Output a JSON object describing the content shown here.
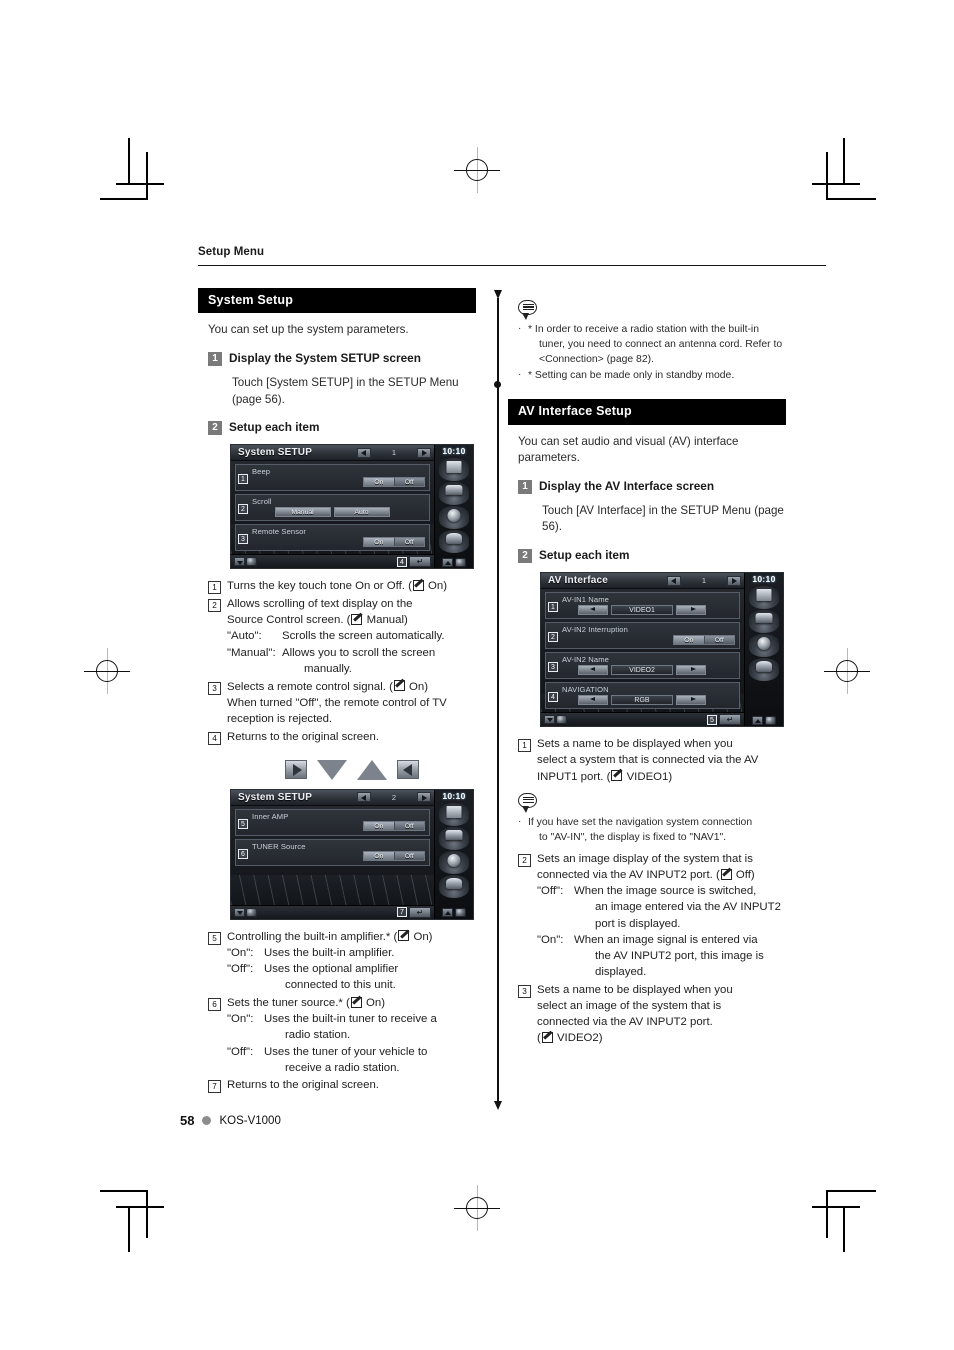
{
  "page": {
    "running_head": "Setup Menu",
    "page_number": "58",
    "model": "KOS-V1000"
  },
  "left_column": {
    "section": {
      "title": "System Setup",
      "intro": "You can set up the system parameters.",
      "steps": [
        {
          "num": "1",
          "label": "Display the System SETUP screen",
          "body": "Touch [System SETUP] in the SETUP Menu (page 56)."
        },
        {
          "num": "2",
          "label": "Setup each item",
          "body": ""
        }
      ]
    },
    "screenshot_1": {
      "title": "System SETUP",
      "page_indicator": "1",
      "clock": "10:10",
      "rows": [
        {
          "marker": "1",
          "label": "Beep",
          "control": "onoff",
          "on": "On",
          "off": "Off",
          "selected": "On"
        },
        {
          "marker": "2",
          "label": "Scroll",
          "control": "pair",
          "left": "Manual",
          "right": "Auto"
        },
        {
          "marker": "3",
          "label": "Remote Sensor",
          "control": "onoff",
          "on": "On",
          "off": "Off",
          "selected": "On"
        }
      ],
      "return_marker": "4"
    },
    "legend_1": [
      {
        "num": "1",
        "lines": [
          "Turns the key touch tone On or Off. (✎ On)"
        ]
      },
      {
        "num": "2",
        "lines": [
          "Allows scrolling of text display on the",
          "Source Control screen. (✎ Manual)"
        ],
        "subs": [
          {
            "key": "\"Auto\":",
            "val": "Scrolls the screen automatically."
          },
          {
            "key": "\"Manual\":",
            "val": "Allows you to scroll the screen"
          },
          {
            "key": "",
            "val": "manually.",
            "deep": true
          }
        ]
      },
      {
        "num": "3",
        "lines": [
          "Selects a remote control signal. (✎ On)",
          "When turned \"Off\", the remote control of TV",
          "reception is rejected."
        ]
      },
      {
        "num": "4",
        "lines": [
          "Returns to the original screen."
        ]
      }
    ],
    "arrow_cluster": [
      "arrow-right-button",
      "arrow-down-triangle",
      "arrow-up-triangle",
      "arrow-left-button"
    ],
    "screenshot_2": {
      "title": "System SETUP",
      "page_indicator": "2",
      "clock": "10:10",
      "rows": [
        {
          "marker": "5",
          "label": "Inner AMP",
          "control": "onoff",
          "on": "On",
          "off": "Off",
          "selected": "On"
        },
        {
          "marker": "6",
          "label": "TUNER Source",
          "control": "onoff",
          "on": "On",
          "off": "Off",
          "selected": "On"
        }
      ],
      "return_marker": "7"
    },
    "legend_2": [
      {
        "num": "5",
        "lines": [
          "Controlling the built-in amplifier.* (✎ On)"
        ],
        "subs": [
          {
            "key": "\"On\":",
            "val": "Uses the built-in amplifier."
          },
          {
            "key": "\"Off\":",
            "val": "Uses the optional amplifier"
          },
          {
            "key": "",
            "val": "connected to this unit.",
            "deep": true
          }
        ]
      },
      {
        "num": "6",
        "lines": [
          "Sets the tuner source.* (✎ On)"
        ],
        "subs": [
          {
            "key": "\"On\":",
            "val": "Uses the built-in tuner to receive a"
          },
          {
            "key": "",
            "val": "radio station.",
            "deep": true
          },
          {
            "key": "\"Off\":",
            "val": "Uses the tuner of your vehicle to"
          },
          {
            "key": "",
            "val": "receive a radio station.",
            "deep": true
          }
        ]
      },
      {
        "num": "7",
        "lines": [
          "Returns to the original screen."
        ]
      }
    ]
  },
  "right_column": {
    "note_top": {
      "icon": "note-bubble-icon",
      "items": [
        {
          "first": "* In order to receive a radio station with the built-in",
          "cont": [
            "tuner, you need to connect an antenna cord. Refer to",
            "<Connection> (page 82)."
          ]
        },
        {
          "first": "* Setting can be made only in standby mode.",
          "cont": []
        }
      ]
    },
    "section": {
      "title": "AV Interface Setup",
      "intro": "You can set audio and visual (AV) interface parameters.",
      "steps": [
        {
          "num": "1",
          "label": "Display the AV Interface screen",
          "body": "Touch [AV Interface] in the SETUP Menu (page 56)."
        },
        {
          "num": "2",
          "label": "Setup each item",
          "body": ""
        }
      ]
    },
    "screenshot_3": {
      "title": "AV Interface",
      "page_indicator": "1",
      "clock": "10:10",
      "rows": [
        {
          "marker": "1",
          "label": "AV-IN1 Name",
          "control": "stepper",
          "value": "VIDEO1"
        },
        {
          "marker": "2",
          "label": "AV-IN2 Interruption",
          "control": "onoff",
          "on": "On",
          "off": "Off",
          "selected": "On"
        },
        {
          "marker": "3",
          "label": "AV-IN2 Name",
          "control": "stepper",
          "value": "VIDEO2"
        },
        {
          "marker": "4",
          "label": "NAVIGATION",
          "control": "stepper",
          "value": "RGB"
        }
      ],
      "return_marker": "5"
    },
    "legend_3a": [
      {
        "num": "1",
        "lines": [
          "Sets a name to be displayed when you",
          "select a system that is connected via the AV",
          "INPUT1 port. (✎ VIDEO1)"
        ]
      }
    ],
    "note_mid": {
      "icon": "note-bubble-icon",
      "items": [
        {
          "first": "If you have set the navigation system connection",
          "cont": [
            "to \"AV-IN\", the display is fixed to \"NAV1\"."
          ]
        }
      ]
    },
    "legend_3b": [
      {
        "num": "2",
        "lines": [
          "Sets an image display of the system that is",
          "connected via the AV INPUT2 port. (✎ Off)"
        ],
        "subs": [
          {
            "key": "\"Off\":",
            "val": "When the image source is switched,"
          },
          {
            "key": "",
            "val": "an image entered via the AV INPUT2",
            "deep": true
          },
          {
            "key": "",
            "val": "port is displayed.",
            "deep": true
          },
          {
            "key": "\"On\":",
            "val": "When an image signal is entered via"
          },
          {
            "key": "",
            "val": "the AV INPUT2 port, this image is",
            "deep": true
          },
          {
            "key": "",
            "val": "displayed.",
            "deep": true
          }
        ]
      },
      {
        "num": "3",
        "lines": [
          "Sets a name to be displayed when you",
          "select an image of the system that is",
          "connected via the AV INPUT2 port.",
          "(✎ VIDEO2)"
        ]
      }
    ]
  }
}
